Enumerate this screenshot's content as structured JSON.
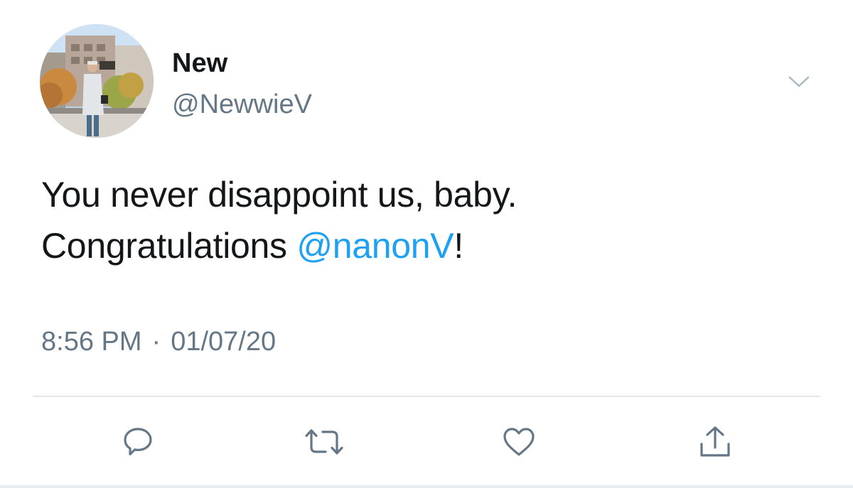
{
  "author": {
    "display_name": "New",
    "handle": "@NewwieV"
  },
  "tweet": {
    "line1": "You never disappoint us, baby.",
    "line2_prefix": "Congratulations ",
    "mention": "@nanonV",
    "line2_suffix": "!"
  },
  "meta": {
    "time": "8:56 PM",
    "separator": "·",
    "date": "01/07/20"
  },
  "actions": [
    "reply-icon",
    "retweet-icon",
    "like-icon",
    "share-icon"
  ],
  "colors": {
    "text": "#14171a",
    "secondary": "#657786",
    "mention": "#1da1f2",
    "divider": "#e1e8ed"
  }
}
